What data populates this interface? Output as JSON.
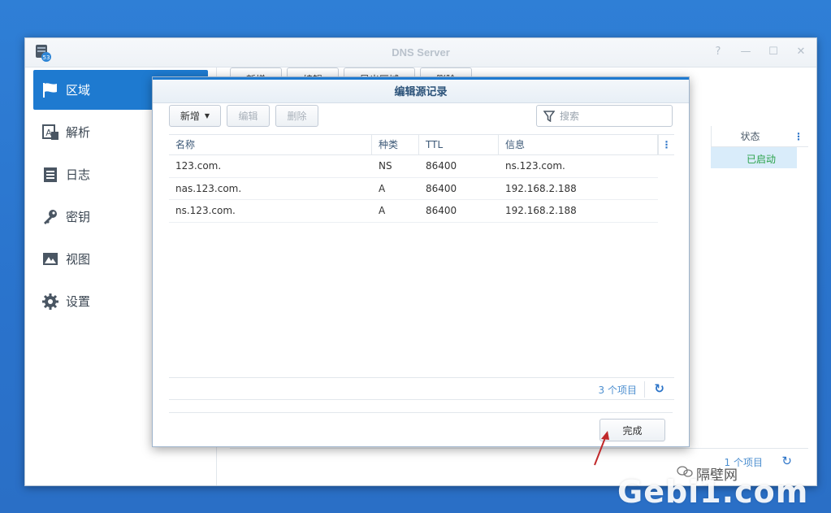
{
  "window": {
    "title": "DNS Server",
    "controls": [
      "?",
      "—",
      "☐",
      "✕"
    ]
  },
  "sidebar": {
    "items": [
      {
        "label": "区域",
        "icon": "flag-icon",
        "active": true
      },
      {
        "label": "解析",
        "icon": "resolve-icon",
        "active": false
      },
      {
        "label": "日志",
        "icon": "log-icon",
        "active": false
      },
      {
        "label": "密钥",
        "icon": "key-icon",
        "active": false
      },
      {
        "label": "视图",
        "icon": "view-icon",
        "active": false
      },
      {
        "label": "设置",
        "icon": "gear-icon",
        "active": false
      }
    ]
  },
  "background": {
    "toolbar": [
      "新增",
      "编辑",
      "导出区域",
      "删除"
    ],
    "status_header": "状态",
    "status_value": "已启动",
    "count": "1 个项目"
  },
  "dialog": {
    "title": "编辑源记录",
    "toolbar": {
      "add": "新增",
      "edit": "编辑",
      "delete": "删除",
      "search_placeholder": "搜索"
    },
    "columns": [
      "名称",
      "种类",
      "TTL",
      "信息"
    ],
    "rows": [
      {
        "name": "123.com.",
        "type": "NS",
        "ttl": "86400",
        "info": "ns.123.com."
      },
      {
        "name": "nas.123.com.",
        "type": "A",
        "ttl": "86400",
        "info": "192.168.2.188"
      },
      {
        "name": "ns.123.com.",
        "type": "A",
        "ttl": "86400",
        "info": "192.168.2.188"
      }
    ],
    "count": "3 个项目",
    "done": "完成"
  },
  "watermark": {
    "text": "Gebi1.com",
    "brand": "隔壁网"
  },
  "colors": {
    "accent": "#1e7ad0",
    "desktop": "#2f7fd6",
    "status_ok": "#2aa24a",
    "arrow": "#c0282a"
  }
}
